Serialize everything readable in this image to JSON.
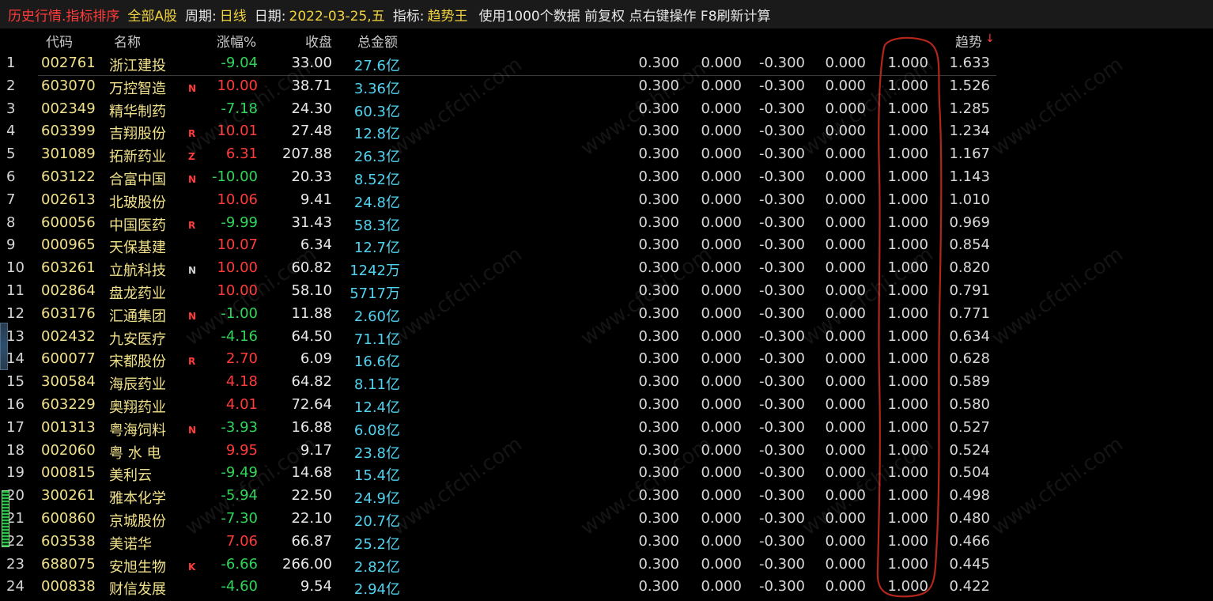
{
  "title": {
    "part1": "历史行情.指标排序",
    "part2": "全部A股",
    "period_label": "周期:",
    "period_value": "日线",
    "date_label": "日期:",
    "date_value": "2022-03-25,五",
    "indicator_label": "指标:",
    "indicator_value": "趋势王",
    "note": "使用1000个数据 前复权 点右键操作 F8刷新计算"
  },
  "columns": {
    "code": "代码",
    "name": "名称",
    "change": "涨幅%",
    "close": "收盘",
    "amount": "总金额",
    "trend": "趋势",
    "sort_arrow": "↓"
  },
  "watermark": "www.cfchi.com",
  "colors": {
    "up": "#ff3b3b",
    "down": "#2fd55a",
    "amount": "#4fd3f0",
    "code": "#f0e08a",
    "annotation": "#c0281e"
  },
  "rows": [
    {
      "idx": "1",
      "code": "002761",
      "name": "浙江建投",
      "flag": "",
      "chg": "-9.04",
      "close": "33.00",
      "amt": "27.6亿",
      "v1": "0.300",
      "v2": "0.000",
      "v3": "-0.300",
      "v4": "0.000",
      "v5": "1.000",
      "v6": "1.633"
    },
    {
      "idx": "2",
      "code": "603070",
      "name": "万控智造",
      "flag": "N",
      "chg": "10.00",
      "close": "38.71",
      "amt": "3.36亿",
      "v1": "0.300",
      "v2": "0.000",
      "v3": "-0.300",
      "v4": "0.000",
      "v5": "1.000",
      "v6": "1.526"
    },
    {
      "idx": "3",
      "code": "002349",
      "name": "精华制药",
      "flag": "",
      "chg": "-7.18",
      "close": "24.30",
      "amt": "60.3亿",
      "v1": "0.300",
      "v2": "0.000",
      "v3": "-0.300",
      "v4": "0.000",
      "v5": "1.000",
      "v6": "1.285"
    },
    {
      "idx": "4",
      "code": "603399",
      "name": "吉翔股份",
      "flag": "R",
      "chg": "10.01",
      "close": "27.48",
      "amt": "12.8亿",
      "v1": "0.300",
      "v2": "0.000",
      "v3": "-0.300",
      "v4": "0.000",
      "v5": "1.000",
      "v6": "1.234"
    },
    {
      "idx": "5",
      "code": "301089",
      "name": "拓新药业",
      "flag": "Z",
      "chg": "6.31",
      "close": "207.88",
      "amt": "26.3亿",
      "v1": "0.300",
      "v2": "0.000",
      "v3": "-0.300",
      "v4": "0.000",
      "v5": "1.000",
      "v6": "1.167"
    },
    {
      "idx": "6",
      "code": "603122",
      "name": "合富中国",
      "flag": "N",
      "chg": "-10.00",
      "close": "20.33",
      "amt": "8.52亿",
      "v1": "0.300",
      "v2": "0.000",
      "v3": "-0.300",
      "v4": "0.000",
      "v5": "1.000",
      "v6": "1.143"
    },
    {
      "idx": "7",
      "code": "002613",
      "name": "北玻股份",
      "flag": "",
      "chg": "10.06",
      "close": "9.41",
      "amt": "24.8亿",
      "v1": "0.300",
      "v2": "0.000",
      "v3": "-0.300",
      "v4": "0.000",
      "v5": "1.000",
      "v6": "1.010"
    },
    {
      "idx": "8",
      "code": "600056",
      "name": "中国医药",
      "flag": "R",
      "chg": "-9.99",
      "close": "31.43",
      "amt": "58.3亿",
      "v1": "0.300",
      "v2": "0.000",
      "v3": "-0.300",
      "v4": "0.000",
      "v5": "1.000",
      "v6": "0.969"
    },
    {
      "idx": "9",
      "code": "000965",
      "name": "天保基建",
      "flag": "",
      "chg": "10.07",
      "close": "6.34",
      "amt": "12.7亿",
      "v1": "0.300",
      "v2": "0.000",
      "v3": "-0.300",
      "v4": "0.000",
      "v5": "1.000",
      "v6": "0.854"
    },
    {
      "idx": "10",
      "code": "603261",
      "name": "立航科技",
      "flag": "N",
      "chg": "10.00",
      "close": "60.82",
      "amt": "1242万",
      "v1": "0.300",
      "v2": "0.000",
      "v3": "-0.300",
      "v4": "0.000",
      "v5": "1.000",
      "v6": "0.820"
    },
    {
      "idx": "11",
      "code": "002864",
      "name": "盘龙药业",
      "flag": "",
      "chg": "10.00",
      "close": "58.10",
      "amt": "5717万",
      "v1": "0.300",
      "v2": "0.000",
      "v3": "-0.300",
      "v4": "0.000",
      "v5": "1.000",
      "v6": "0.791"
    },
    {
      "idx": "12",
      "code": "603176",
      "name": "汇通集团",
      "flag": "N",
      "chg": "-1.00",
      "close": "11.88",
      "amt": "2.60亿",
      "v1": "0.300",
      "v2": "0.000",
      "v3": "-0.300",
      "v4": "0.000",
      "v5": "1.000",
      "v6": "0.771"
    },
    {
      "idx": "13",
      "code": "002432",
      "name": "九安医疗",
      "flag": "",
      "chg": "-4.16",
      "close": "64.50",
      "amt": "71.1亿",
      "v1": "0.300",
      "v2": "0.000",
      "v3": "-0.300",
      "v4": "0.000",
      "v5": "1.000",
      "v6": "0.634"
    },
    {
      "idx": "14",
      "code": "600077",
      "name": "宋都股份",
      "flag": "R",
      "chg": "2.70",
      "close": "6.09",
      "amt": "16.6亿",
      "v1": "0.300",
      "v2": "0.000",
      "v3": "-0.300",
      "v4": "0.000",
      "v5": "1.000",
      "v6": "0.628"
    },
    {
      "idx": "15",
      "code": "300584",
      "name": "海辰药业",
      "flag": "",
      "chg": "4.18",
      "close": "64.82",
      "amt": "8.11亿",
      "v1": "0.300",
      "v2": "0.000",
      "v3": "-0.300",
      "v4": "0.000",
      "v5": "1.000",
      "v6": "0.589"
    },
    {
      "idx": "16",
      "code": "603229",
      "name": "奥翔药业",
      "flag": "",
      "chg": "4.01",
      "close": "72.64",
      "amt": "12.4亿",
      "v1": "0.300",
      "v2": "0.000",
      "v3": "-0.300",
      "v4": "0.000",
      "v5": "1.000",
      "v6": "0.580"
    },
    {
      "idx": "17",
      "code": "001313",
      "name": "粤海饲料",
      "flag": "N",
      "chg": "-3.93",
      "close": "16.88",
      "amt": "6.08亿",
      "v1": "0.300",
      "v2": "0.000",
      "v3": "-0.300",
      "v4": "0.000",
      "v5": "1.000",
      "v6": "0.527"
    },
    {
      "idx": "18",
      "code": "002060",
      "name": "粤 水 电",
      "flag": "",
      "chg": "9.95",
      "close": "9.17",
      "amt": "23.8亿",
      "v1": "0.300",
      "v2": "0.000",
      "v3": "-0.300",
      "v4": "0.000",
      "v5": "1.000",
      "v6": "0.524"
    },
    {
      "idx": "19",
      "code": "000815",
      "name": "美利云",
      "flag": "",
      "chg": "-9.49",
      "close": "14.68",
      "amt": "15.4亿",
      "v1": "0.300",
      "v2": "0.000",
      "v3": "-0.300",
      "v4": "0.000",
      "v5": "1.000",
      "v6": "0.504"
    },
    {
      "idx": "20",
      "code": "300261",
      "name": "雅本化学",
      "flag": "",
      "chg": "-5.94",
      "close": "22.50",
      "amt": "24.9亿",
      "v1": "0.300",
      "v2": "0.000",
      "v3": "-0.300",
      "v4": "0.000",
      "v5": "1.000",
      "v6": "0.498"
    },
    {
      "idx": "21",
      "code": "600860",
      "name": "京城股份",
      "flag": "",
      "chg": "-7.30",
      "close": "22.10",
      "amt": "20.7亿",
      "v1": "0.300",
      "v2": "0.000",
      "v3": "-0.300",
      "v4": "0.000",
      "v5": "1.000",
      "v6": "0.480"
    },
    {
      "idx": "22",
      "code": "603538",
      "name": "美诺华",
      "flag": "",
      "chg": "7.06",
      "close": "66.87",
      "amt": "25.2亿",
      "v1": "0.300",
      "v2": "0.000",
      "v3": "-0.300",
      "v4": "0.000",
      "v5": "1.000",
      "v6": "0.466"
    },
    {
      "idx": "23",
      "code": "688075",
      "name": "安旭生物",
      "flag": "K",
      "chg": "-6.66",
      "close": "266.00",
      "amt": "2.82亿",
      "v1": "0.300",
      "v2": "0.000",
      "v3": "-0.300",
      "v4": "0.000",
      "v5": "1.000",
      "v6": "0.445"
    },
    {
      "idx": "24",
      "code": "000838",
      "name": "财信发展",
      "flag": "",
      "chg": "-4.60",
      "close": "9.54",
      "amt": "2.94亿",
      "v1": "0.300",
      "v2": "0.000",
      "v3": "-0.300",
      "v4": "0.000",
      "v5": "1.000",
      "v6": "0.422"
    }
  ]
}
